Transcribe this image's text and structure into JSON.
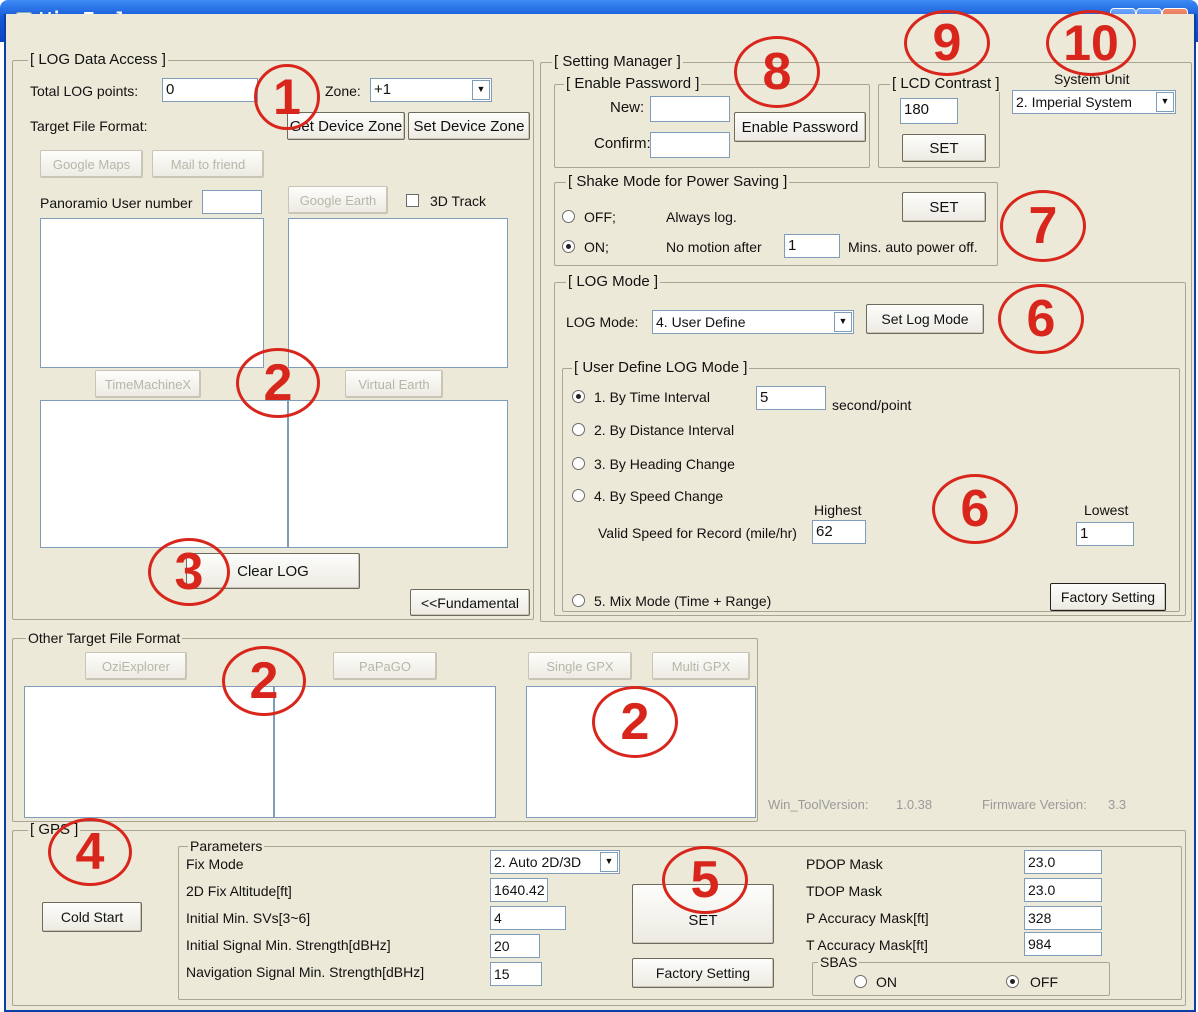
{
  "window": {
    "title": "Win_Tool",
    "controls": [
      "_",
      "□",
      "✕"
    ]
  },
  "log_access": {
    "legend": "[ LOG Data Access ]",
    "total_points_label": "Total LOG points:",
    "total_points_value": "0",
    "zone_label": "Zone:",
    "zone_value": "+1",
    "target_format_label": "Target File Format:",
    "get_zone_button": "Get Device Zone",
    "set_zone_button": "Set Device Zone",
    "google_maps_button": "Google Maps",
    "mail_friend_button": "Mail to friend",
    "panoramio_label": "Panoramio User number",
    "panoramio_value": "",
    "google_earth_button": "Google Earth",
    "track3d_label": "3D Track",
    "timemachine_button": "TimeMachineX",
    "virtual_earth_button": "Virtual Earth",
    "clear_log_button": "Clear LOG",
    "fundamental_button": "<<Fundamental"
  },
  "other_format": {
    "legend": "Other Target File Format",
    "ozi_button": "OziExplorer",
    "papago_button": "PaPaGO",
    "single_gpx_button": "Single GPX",
    "multi_gpx_button": "Multi GPX"
  },
  "setting_manager": {
    "legend": "[ Setting Manager ]",
    "password": {
      "legend": "[ Enable Password ]",
      "new_label": "New:",
      "confirm_label": "Confirm:",
      "enable_button": "Enable Password"
    },
    "lcd": {
      "legend": "[ LCD Contrast ]",
      "value": "180",
      "set_button": "SET"
    },
    "system_unit": {
      "label": "System Unit",
      "value": "2. Imperial System"
    },
    "shake": {
      "legend": "[ Shake Mode for Power Saving ]",
      "off_label": "OFF;",
      "off_desc": "Always log.",
      "on_label": "ON;",
      "on_desc": "No motion after",
      "minutes_value": "1",
      "minutes_desc": "Mins. auto power off.",
      "set_button": "SET"
    },
    "log_mode": {
      "legend": "[ LOG Mode ]",
      "label": "LOG Mode:",
      "value": "4. User Define",
      "set_button": "Set Log Mode"
    },
    "user_define": {
      "legend": "[ User Define LOG Mode ]",
      "opt1": "1. By Time Interval",
      "interval_value": "5",
      "interval_unit": "second/point",
      "opt2": "2. By Distance Interval",
      "opt3": "3. By Heading Change",
      "opt4": "4. By Speed Change",
      "highest_label": "Highest",
      "lowest_label": "Lowest",
      "valid_speed_label": "Valid Speed for Record (mile/hr)",
      "highest_value": "62",
      "lowest_value": "1",
      "opt5": "5. Mix Mode (Time + Range)",
      "factory_button": "Factory Setting"
    }
  },
  "version": {
    "tool_label": "Win_ToolVersion:",
    "tool_value": "1.0.38",
    "fw_label": "Firmware Version:",
    "fw_value": "3.3"
  },
  "gps": {
    "legend": "[ GPS ]",
    "cold_start_button": "Cold Start",
    "params_legend": "Parameters",
    "fix_mode_label": "Fix Mode",
    "fix_mode_value": "2. Auto 2D/3D",
    "alt_label": "2D Fix Altitude[ft]",
    "alt_value": "1640.42",
    "svs_label": "Initial Min. SVs[3~6]",
    "svs_value": "4",
    "init_sig_label": "Initial Signal Min. Strength[dBHz]",
    "init_sig_value": "20",
    "nav_sig_label": "Navigation Signal Min. Strength[dBHz]",
    "nav_sig_value": "15",
    "set_button": "SET",
    "factory_button": "Factory Setting",
    "pdop_label": "PDOP Mask",
    "pdop_value": "23.0",
    "tdop_label": "TDOP Mask",
    "tdop_value": "23.0",
    "pacc_label": "P Accuracy Mask[ft]",
    "pacc_value": "328",
    "tacc_label": "T Accuracy Mask[ft]",
    "tacc_value": "984",
    "sbas_legend": "SBAS",
    "sbas_on": "ON",
    "sbas_off": "OFF"
  },
  "annotations": [
    "1",
    "2",
    "2",
    "2",
    "3",
    "4",
    "5",
    "6",
    "6",
    "7",
    "8",
    "9",
    "10"
  ],
  "colors": {
    "annotation": "#d9261c",
    "titlebar": "#1356d6",
    "panel": "#ece9d8"
  }
}
